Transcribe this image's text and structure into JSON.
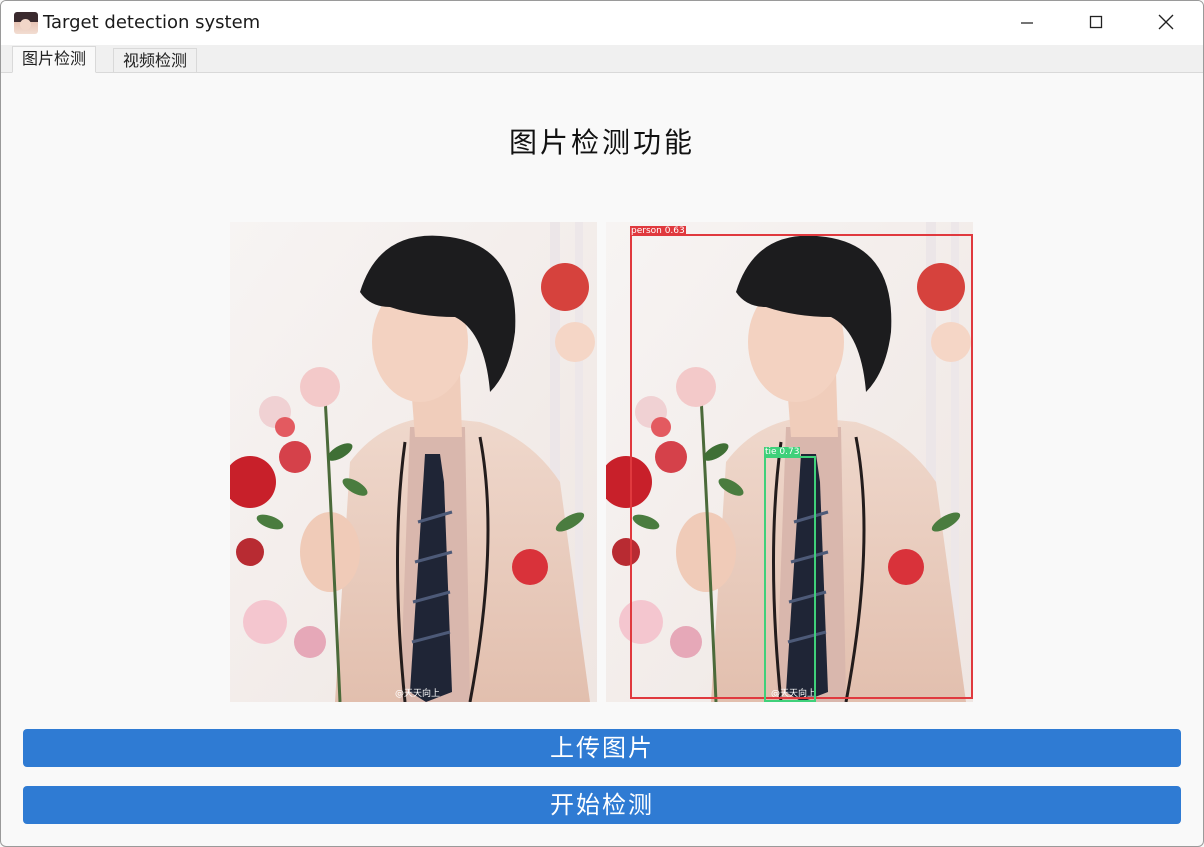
{
  "window": {
    "title": "Target detection system"
  },
  "tabs": [
    {
      "label": "图片检测",
      "active": true
    },
    {
      "label": "视频检测",
      "active": false
    }
  ],
  "main": {
    "heading": "图片检测功能",
    "watermark": "@天天向上",
    "detections": [
      {
        "label": "person 0.63",
        "color": "#e0393e"
      },
      {
        "label": "tie 0.73",
        "color": "#3fd07a"
      }
    ]
  },
  "buttons": {
    "upload_label": "上传图片",
    "detect_label": "开始检测"
  },
  "colors": {
    "accent": "#2f7bd3",
    "person_box": "#e0393e",
    "tie_box": "#3fd07a"
  }
}
